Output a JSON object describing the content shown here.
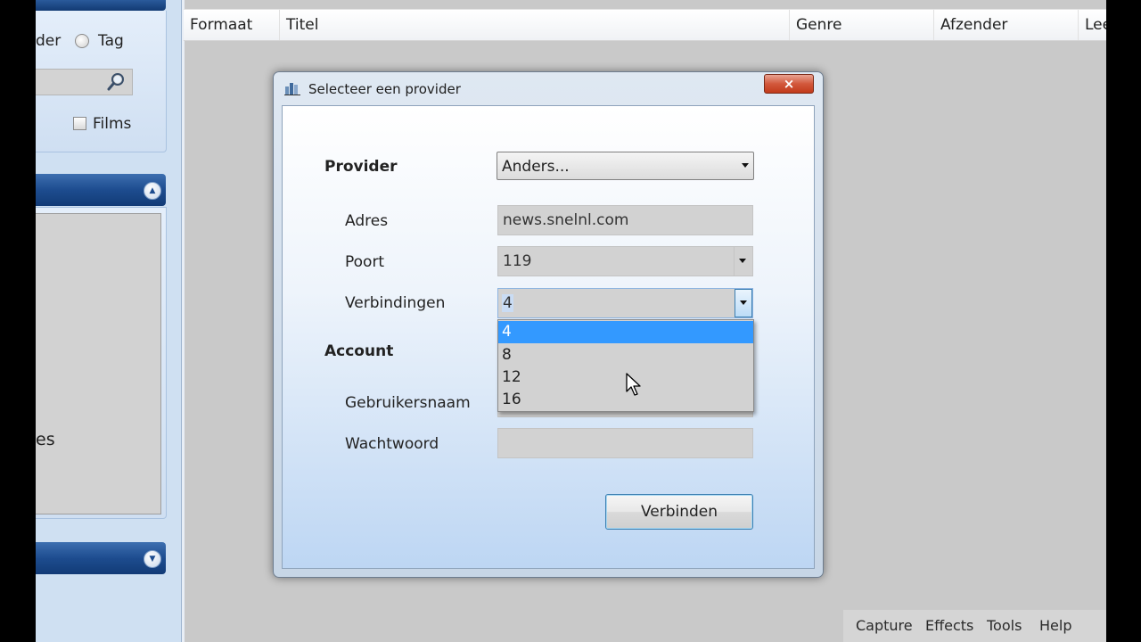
{
  "left_panel": {
    "radio_label_partial": "der",
    "radio_tag_label": "Tag",
    "films_label": "Films",
    "es_label": "es"
  },
  "list": {
    "columns": [
      "Formaat",
      "Titel",
      "Genre",
      "Afzender",
      "Lee"
    ]
  },
  "status_bar": {
    "items": [
      "Capture",
      "Effects",
      "Tools",
      "Help"
    ]
  },
  "dialog": {
    "title": "Selecteer een provider",
    "close_label": "×",
    "provider_label": "Provider",
    "provider_value": "Anders...",
    "adres_label": "Adres",
    "adres_value": "news.snelnl.com",
    "poort_label": "Poort",
    "poort_value": "119",
    "verbindingen_label": "Verbindingen",
    "verbindingen_value": "4",
    "verbindingen_options": [
      "4",
      "8",
      "12",
      "16"
    ],
    "account_label": "Account",
    "gebruikersnaam_label": "Gebruikersnaam",
    "wachtwoord_label": "Wachtwoord",
    "connect_label": "Verbinden"
  },
  "colors": {
    "selection": "#3399ff",
    "header_blue": "#1d4c8f",
    "close_red": "#c23a1b"
  }
}
